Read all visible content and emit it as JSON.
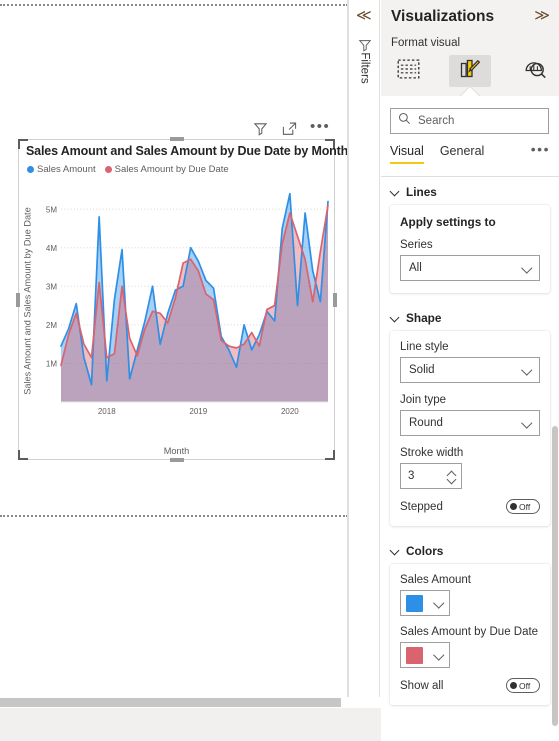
{
  "report": {
    "visual_header": {
      "filter_icon": "filter-icon",
      "focus_icon": "focus-mode-icon",
      "more_label": "•••"
    },
    "visual": {
      "title": "Sales Amount and Sales Amount by Due Date by Month",
      "y_axis_title": "Sales Amount and Sales Amount by Due Date",
      "x_axis_title": "Month",
      "legend": [
        {
          "label": "Sales Amount",
          "color": "#2e8fe6"
        },
        {
          "label": "Sales Amount by Due Date",
          "color": "#d9636f"
        }
      ]
    }
  },
  "filters_rail": {
    "collapse_label": "≪",
    "filter_icon": "filter-icon",
    "title": "Filters"
  },
  "viz_pane": {
    "title": "Visualizations",
    "expand_label": "≫",
    "subtitle": "Format visual",
    "tabs": [
      {
        "name": "fields",
        "icon": "fields-build-visual-icon",
        "active": false
      },
      {
        "name": "format",
        "icon": "format-paint-bar-icon",
        "active": true
      },
      {
        "name": "analytics",
        "icon": "analytics-magnifier-icon",
        "active": false
      }
    ],
    "search": {
      "placeholder": "Search",
      "value": "",
      "icon": "search-icon"
    },
    "sub_tabs": [
      {
        "label": "Visual",
        "active": true
      },
      {
        "label": "General",
        "active": false
      }
    ],
    "sub_tabs_more": "•••",
    "accent_color": "#f2c811",
    "sections": {
      "lines": {
        "header": "Lines",
        "apply_settings": {
          "card_title": "Apply settings to",
          "series_label": "Series",
          "series_value": "All"
        },
        "shape": {
          "header": "Shape",
          "line_style_label": "Line style",
          "line_style_value": "Solid",
          "join_type_label": "Join type",
          "join_type_value": "Round",
          "stroke_width_label": "Stroke width",
          "stroke_width_value": "3",
          "stepped_label": "Stepped",
          "stepped_state": "Off"
        },
        "colors": {
          "header": "Colors",
          "items": [
            {
              "label": "Sales Amount",
              "color": "#2e8fe6"
            },
            {
              "label": "Sales Amount by Due Date",
              "color": "#d9636f"
            }
          ],
          "show_all_label": "Show all",
          "show_all_state": "Off"
        }
      }
    }
  },
  "chart_data": {
    "type": "area",
    "title": "Sales Amount and Sales Amount by Due Date by Month",
    "xlabel": "Month",
    "ylabel": "Sales Amount and Sales Amount by Due Date",
    "ylim": [
      0,
      5600000
    ],
    "ytick_labels": [
      "1M",
      "2M",
      "3M",
      "4M",
      "5M"
    ],
    "ytick_values": [
      1000000,
      2000000,
      3000000,
      4000000,
      5000000
    ],
    "xtick_labels": [
      "2018",
      "2019",
      "2020"
    ],
    "grid": true,
    "legend_position": "top-left",
    "x": [
      "2017-07",
      "2017-08",
      "2017-09",
      "2017-10",
      "2017-11",
      "2017-12",
      "2018-01",
      "2018-02",
      "2018-03",
      "2018-04",
      "2018-05",
      "2018-06",
      "2018-07",
      "2018-08",
      "2018-09",
      "2018-10",
      "2018-11",
      "2018-12",
      "2019-01",
      "2019-02",
      "2019-03",
      "2019-04",
      "2019-05",
      "2019-06",
      "2019-07",
      "2019-08",
      "2019-09",
      "2019-10",
      "2019-11",
      "2019-12",
      "2020-01",
      "2020-02",
      "2020-03",
      "2020-04",
      "2020-05",
      "2020-06"
    ],
    "series": [
      {
        "name": "Sales Amount",
        "color": "#2e8fe6",
        "values": [
          1450000,
          1900000,
          2550000,
          1150000,
          450000,
          4800000,
          550000,
          2650000,
          3950000,
          600000,
          1350000,
          2100000,
          3000000,
          1500000,
          2300000,
          2900000,
          3000000,
          4000000,
          3650000,
          3150000,
          2950000,
          1700000,
          1350000,
          900000,
          2000000,
          1350000,
          1750000,
          2350000,
          2100000,
          4500000,
          5400000,
          2500000,
          4900000,
          3400000,
          2600000,
          5200000
        ]
      },
      {
        "name": "Sales Amount by Due Date",
        "color": "#d9636f",
        "values": [
          950000,
          1750000,
          2300000,
          1500000,
          1150000,
          3100000,
          1150000,
          1250000,
          3000000,
          1650000,
          1200000,
          1900000,
          2350000,
          2300000,
          2050000,
          2700000,
          3600000,
          3700000,
          3400000,
          2800000,
          2650000,
          1600000,
          1450000,
          1400000,
          1500000,
          1800000,
          1450000,
          2400000,
          2500000,
          4100000,
          4900000,
          4300000,
          3700000,
          2600000,
          3900000,
          5100000
        ]
      }
    ]
  }
}
